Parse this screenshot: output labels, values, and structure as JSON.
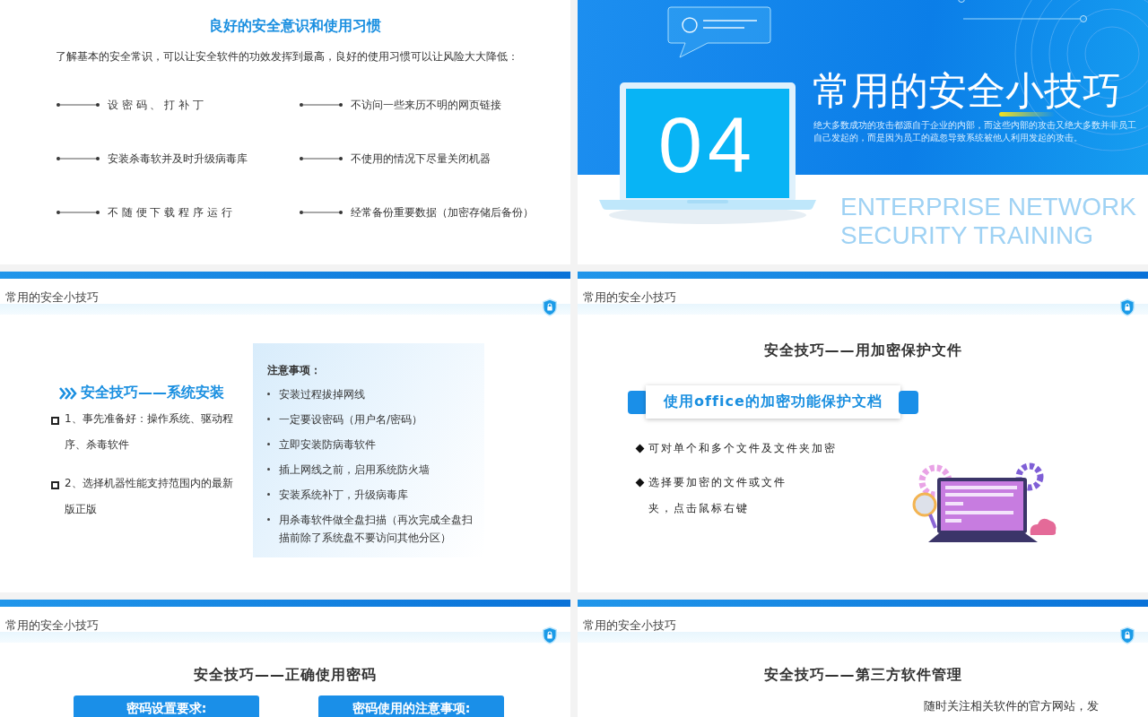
{
  "slides": [
    {
      "kind": "habits",
      "title": "良好的安全意识和使用习惯",
      "intro": "了解基本的安全常识，可以让安全软件的功效发挥到最高，良好的使用习惯可以让风险大大降低：",
      "items": [
        "设 密 码 、 打 补 丁",
        "不访问一些来历不明的网页链接",
        "安装杀毒软并及时升级病毒库",
        "不使用的情况下尽量关闭机器",
        "不 随 便 下 载 程 序 运 行",
        "经常备份重要数据（加密存储后备份）"
      ]
    },
    {
      "kind": "section",
      "number": "04",
      "title": "常用的安全小技巧",
      "description": "绝大多数成功的攻击都源自于企业的内部，而这些内部的攻击又绝大多数并非员工自己发起的，而是因为员工的疏忽导致系统被他人利用发起的攻击。",
      "subtitle_lines": [
        "ENTERPRISE NETWORK",
        "SECURITY TRAINING"
      ]
    },
    {
      "kind": "install",
      "header": "常用的安全小技巧",
      "heading": "安全技巧——系统安装",
      "steps": [
        "1、事先准备好：操作系统、驱动程序、杀毒软件",
        "2、选择机器性能支持范围内的最新版正版"
      ],
      "notes_title": "注意事项：",
      "notes": [
        "安装过程拔掉网线",
        "一定要设密码（用户名/密码）",
        "立即安装防病毒软件",
        "插上网线之前，启用系统防火墙",
        "安装系统补丁，升级病毒库",
        "用杀毒软件做全盘扫描（再次完成全盘扫描前除了系统盘不要访问其他分区）"
      ]
    },
    {
      "kind": "encrypt",
      "header": "常用的安全小技巧",
      "heading": "安全技巧——用加密保护文件",
      "banner": "使用office的加密功能保护文档",
      "points": [
        "可对单个和多个文件及文件夹加密",
        "选择要加密的文件或文件夹，点击鼠标右键"
      ]
    },
    {
      "kind": "password",
      "header": "常用的安全小技巧",
      "heading": "安全技巧——正确使用密码",
      "buttons": [
        "密码设置要求:",
        "密码使用的注意事项:"
      ]
    },
    {
      "kind": "software",
      "header": "常用的安全小技巧",
      "heading": "安全技巧——第三方软件管理",
      "points": [
        "随时关注相关软件的官方网站，发"
      ]
    }
  ]
}
